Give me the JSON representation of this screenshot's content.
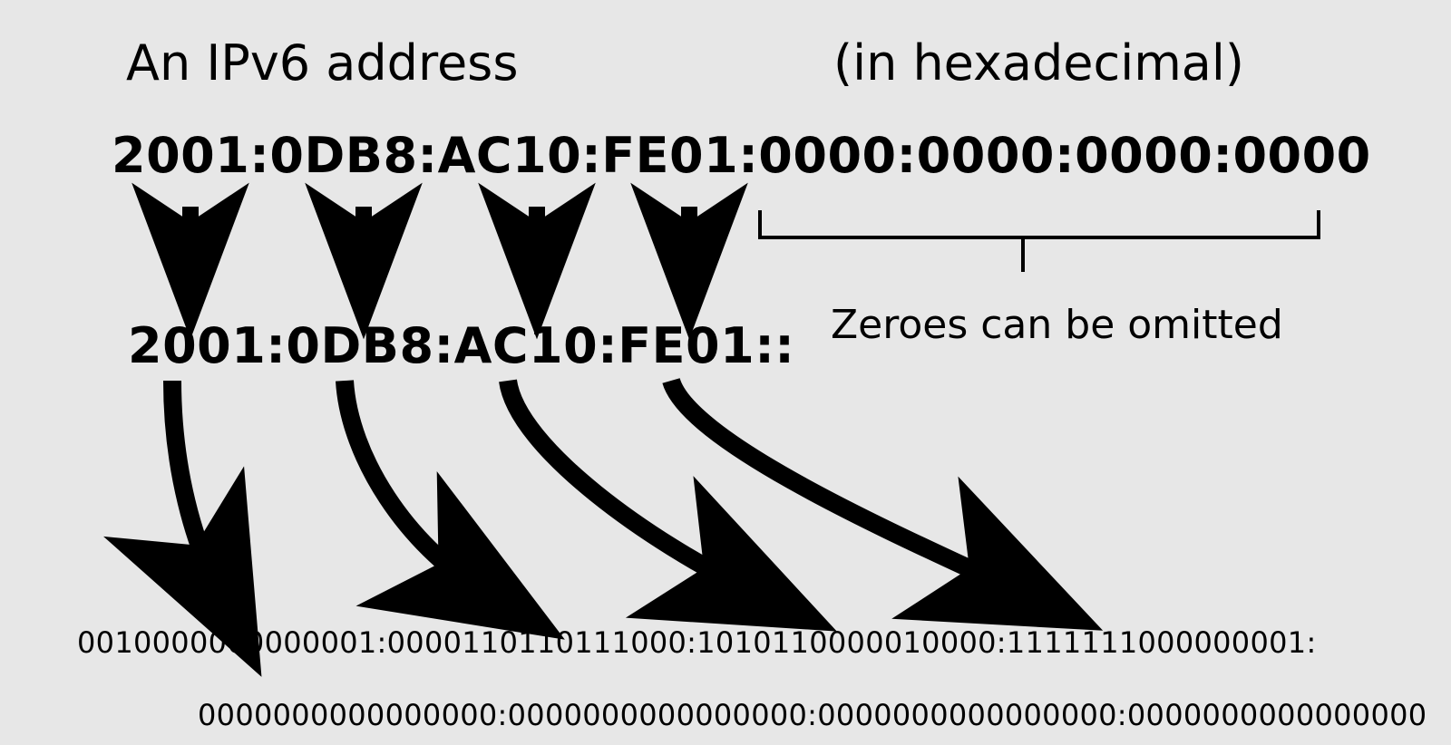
{
  "title_left": "An IPv6 address",
  "title_right": "(in hexadecimal)",
  "hex_full": "2001:0DB8:AC10:FE01:0000:0000:0000:0000",
  "hex_short": "2001:0DB8:AC10:FE01::",
  "omit_label": "Zeroes can be omitted",
  "binary_line1": "0010000000000001:0000110110111000:1010110000010000:1111111000000001:",
  "binary_line2": "0000000000000000:0000000000000000:0000000000000000:0000000000000000"
}
